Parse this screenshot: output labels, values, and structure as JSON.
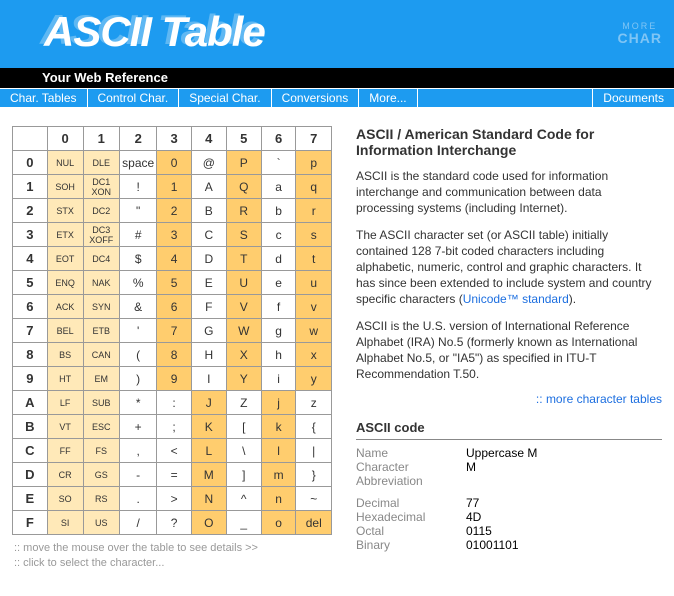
{
  "header": {
    "title": "ASCII Table",
    "logo_top": "MORE",
    "logo_bottom": "CHAR"
  },
  "subheader": "Your Web Reference",
  "nav": [
    "Char. Tables",
    "Control Char.",
    "Special Char.",
    "Conversions",
    "More...",
    "Documents"
  ],
  "table": {
    "col_headers": [
      "0",
      "1",
      "2",
      "3",
      "4",
      "5",
      "6",
      "7"
    ],
    "row_headers": [
      "0",
      "1",
      "2",
      "3",
      "4",
      "5",
      "6",
      "7",
      "8",
      "9",
      "A",
      "B",
      "C",
      "D",
      "E",
      "F"
    ],
    "cells": [
      [
        "NUL",
        "DLE",
        "space",
        "0",
        "@",
        "P",
        "`",
        "p"
      ],
      [
        "SOH",
        "DC1\nXON",
        "!",
        "1",
        "A",
        "Q",
        "a",
        "q"
      ],
      [
        "STX",
        "DC2",
        "\"",
        "2",
        "B",
        "R",
        "b",
        "r"
      ],
      [
        "ETX",
        "DC3\nXOFF",
        "#",
        "3",
        "C",
        "S",
        "c",
        "s"
      ],
      [
        "EOT",
        "DC4",
        "$",
        "4",
        "D",
        "T",
        "d",
        "t"
      ],
      [
        "ENQ",
        "NAK",
        "%",
        "5",
        "E",
        "U",
        "e",
        "u"
      ],
      [
        "ACK",
        "SYN",
        "&",
        "6",
        "F",
        "V",
        "f",
        "v"
      ],
      [
        "BEL",
        "ETB",
        "'",
        "7",
        "G",
        "W",
        "g",
        "w"
      ],
      [
        "BS",
        "CAN",
        "(",
        "8",
        "H",
        "X",
        "h",
        "x"
      ],
      [
        "HT",
        "EM",
        ")",
        "9",
        "I",
        "Y",
        "i",
        "y"
      ],
      [
        "LF",
        "SUB",
        "*",
        ":",
        "J",
        "Z",
        "j",
        "z"
      ],
      [
        "VT",
        "ESC",
        "+",
        ";",
        "K",
        "[",
        "k",
        "{"
      ],
      [
        "FF",
        "FS",
        ",",
        "<",
        "L",
        "\\",
        "l",
        "|"
      ],
      [
        "CR",
        "GS",
        "-",
        "=",
        "M",
        "]",
        "m",
        "}"
      ],
      [
        "SO",
        "RS",
        ".",
        ">",
        "N",
        "^",
        "n",
        "~"
      ],
      [
        "SI",
        "US",
        "/",
        "?",
        "O",
        "_",
        "o",
        "del"
      ]
    ],
    "shade": [
      [
        0,
        0,
        0,
        1,
        0,
        1,
        0,
        1
      ],
      [
        0,
        0,
        0,
        1,
        0,
        1,
        0,
        1
      ],
      [
        0,
        0,
        0,
        1,
        0,
        1,
        0,
        1
      ],
      [
        0,
        0,
        0,
        1,
        0,
        1,
        0,
        1
      ],
      [
        0,
        0,
        0,
        1,
        0,
        1,
        0,
        1
      ],
      [
        0,
        0,
        0,
        1,
        0,
        1,
        0,
        1
      ],
      [
        0,
        0,
        0,
        1,
        0,
        1,
        0,
        1
      ],
      [
        0,
        0,
        0,
        1,
        0,
        1,
        0,
        1
      ],
      [
        0,
        0,
        0,
        1,
        0,
        1,
        0,
        1
      ],
      [
        0,
        0,
        0,
        1,
        0,
        1,
        0,
        1
      ],
      [
        0,
        0,
        0,
        0,
        1,
        0,
        1,
        0
      ],
      [
        0,
        0,
        0,
        0,
        1,
        0,
        1,
        0
      ],
      [
        0,
        0,
        0,
        0,
        1,
        0,
        1,
        0
      ],
      [
        0,
        0,
        0,
        0,
        1,
        0,
        1,
        0
      ],
      [
        0,
        0,
        0,
        0,
        1,
        0,
        1,
        0
      ],
      [
        0,
        0,
        0,
        0,
        1,
        0,
        1,
        1
      ]
    ]
  },
  "instructions": {
    "line1": ":: move the mouse over the table to see details  >>",
    "line2": ":: click to select the character..."
  },
  "article": {
    "title": "ASCII / American Standard Code for Information Interchange",
    "p1": "ASCII is the standard code used for information interchange and communication between data processing systems (including Internet).",
    "p2a": "The ASCII character set (or ASCII table) initially contained 128 7-bit coded characters including alphabetic, numeric, control and graphic characters. It has since been extended to include system and country specific characters (",
    "p2_link": "Unicode™ standard",
    "p2b": ").",
    "p3": "ASCII is the U.S. version of International Reference Alphabet (IRA) No.5 (formerly known as International Alphabet No.5, or \"IA5\") as specified in ITU-T Recommendation T.50.",
    "more_link": "more character tables"
  },
  "code": {
    "heading": "ASCII code",
    "rows": [
      {
        "label": "Name",
        "value": "Uppercase M"
      },
      {
        "label": "Character",
        "value": "M"
      },
      {
        "label": "Abbreviation",
        "value": ""
      }
    ],
    "rows2": [
      {
        "label": "Decimal",
        "value": "77"
      },
      {
        "label": "Hexadecimal",
        "value": "4D"
      },
      {
        "label": "Octal",
        "value": "0115"
      },
      {
        "label": "Binary",
        "value": "01001101"
      }
    ]
  }
}
